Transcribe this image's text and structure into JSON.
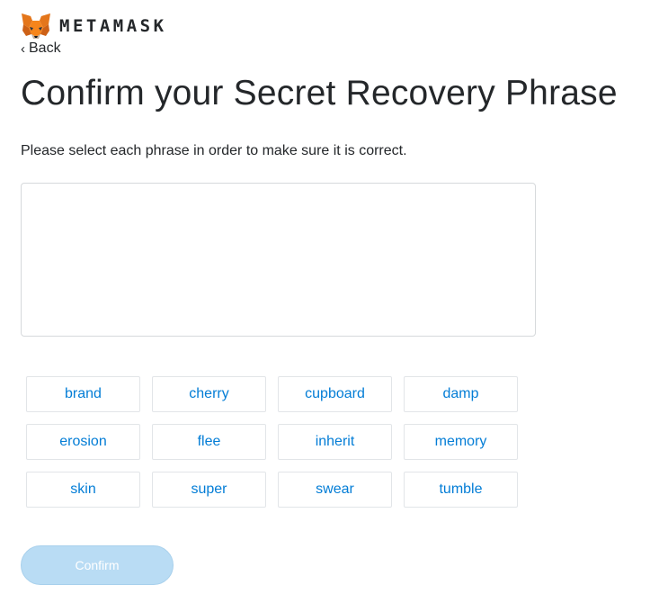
{
  "header": {
    "logo_icon": "metamask-fox-icon",
    "brand_text": "METAMASK"
  },
  "back": {
    "icon": "chevron-left-icon",
    "label": "Back"
  },
  "main": {
    "title": "Confirm your Secret Recovery Phrase",
    "subtitle": "Please select each phrase in order to make sure it is correct."
  },
  "words": [
    "brand",
    "cherry",
    "cupboard",
    "damp",
    "erosion",
    "flee",
    "inherit",
    "memory",
    "skin",
    "super",
    "swear",
    "tumble"
  ],
  "confirm": {
    "label": "Confirm",
    "disabled": true
  },
  "colors": {
    "text": "#24272a",
    "link": "#037dd6",
    "button_disabled_bg": "#b9dcf4",
    "fox_orange": "#e2761b"
  }
}
